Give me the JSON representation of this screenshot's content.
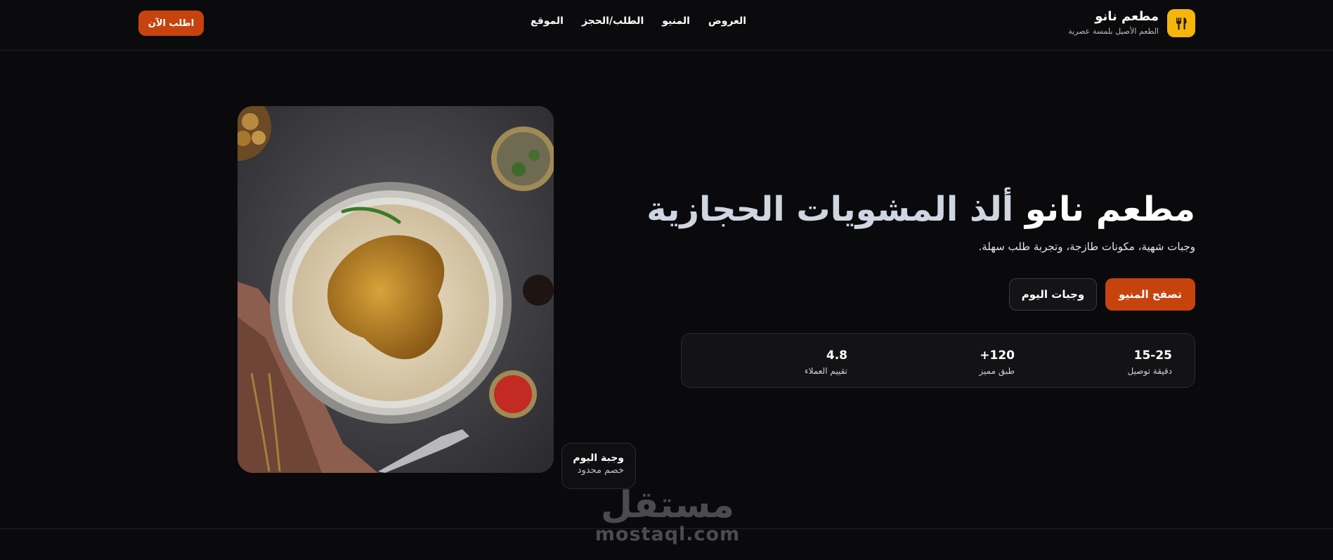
{
  "header": {
    "brand_name": "مطعم نانو",
    "brand_tagline": "الطعم الأصيل بلمسة عصرية",
    "logo_icon": "fork-knife-icon",
    "nav": [
      "العروض",
      "المنيو",
      "الطلب/الحجز",
      "الموقع"
    ],
    "order_button": "اطلب الآن"
  },
  "hero": {
    "title_part1": "مطعم نانو",
    "title_part2": "ألذ المشويات الحجازية",
    "subtitle": "وجبات شهية، مكونات طازجة، وتجربة طلب سهلة.",
    "primary_button": "تصفح المنيو",
    "secondary_button": "وجبات اليوم",
    "stats": [
      {
        "value": "15-25",
        "label": "دقيقة توصيل"
      },
      {
        "value": "+120",
        "label": "طبق مميز"
      },
      {
        "value": "4.8",
        "label": "تقييم العملاء"
      }
    ],
    "daily_badge": {
      "title": "وجبة اليوم",
      "subtitle": "خصم محدود"
    }
  },
  "watermark": {
    "arabic": "مستقل",
    "latin": "mostaql.com"
  },
  "colors": {
    "accent": "#c7430e",
    "logo": "#f5b50a",
    "background": "#0a0a0c"
  }
}
